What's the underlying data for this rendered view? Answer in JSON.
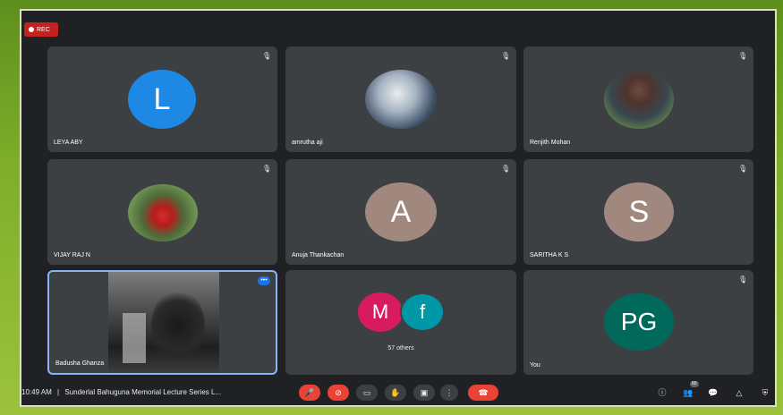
{
  "recording": {
    "label": "REC"
  },
  "participants": [
    {
      "name": "LEYA ABY",
      "initial": "L",
      "color": "#1e88e5",
      "type": "initial"
    },
    {
      "name": "amrutha aji",
      "type": "photo"
    },
    {
      "name": "Renjith Mohan",
      "type": "photo"
    },
    {
      "name": "VIJAY RAJ N",
      "type": "photo"
    },
    {
      "name": "Anuja Thankachan",
      "initial": "A",
      "color": "#a1887f",
      "type": "initial"
    },
    {
      "name": "SARITHA K S",
      "initial": "S",
      "color": "#a1887f",
      "type": "initial"
    },
    {
      "name": "Badusha Ghanza",
      "type": "video",
      "speaking": "•••"
    },
    {
      "name": "",
      "type": "others",
      "initials": [
        "M",
        "f"
      ],
      "colors": [
        "#d81b60",
        "#0097a7"
      ],
      "label": "57 others"
    },
    {
      "name": "You",
      "initial": "PG",
      "color": "#00695c",
      "type": "initial"
    }
  ],
  "bottombar": {
    "time": "10:49 AM",
    "separator": "|",
    "meeting_title": "Sunderlal Bahuguna Memorial Lecture Series L...",
    "people_count": "60"
  },
  "icons": {
    "mic_off": "mic-off-icon",
    "cam_off": "camera-off-icon",
    "captions": "captions-icon",
    "hand": "raise-hand-icon",
    "present": "present-icon",
    "more": "more-icon",
    "end": "end-call-icon",
    "info": "info-icon",
    "people": "people-icon",
    "chat": "chat-icon",
    "activities": "activities-icon",
    "host": "host-controls-icon"
  }
}
